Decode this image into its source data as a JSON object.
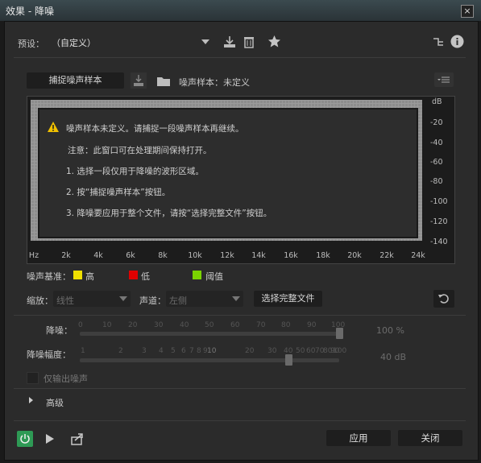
{
  "window": {
    "title": "效果 - 降噪",
    "close_glyph": "×"
  },
  "preset": {
    "label": "预设：",
    "value": "（自定义）",
    "icons": [
      "download-icon",
      "trash-icon",
      "star-icon"
    ],
    "right_icons": [
      "routing-icon",
      "info-icon"
    ]
  },
  "capture": {
    "button": "捕捉噪声样本",
    "sample_label": "噪声样本：未定义",
    "icons": [
      "save-icon",
      "folder-icon",
      "menu-list-icon"
    ]
  },
  "graph": {
    "y_ticks": [
      "dB",
      "-20",
      "-40",
      "-60",
      "-80",
      "-100",
      "-120",
      "-140"
    ],
    "x_ticks": [
      "Hz",
      "2k",
      "4k",
      "6k",
      "8k",
      "10k",
      "12k",
      "14k",
      "16k",
      "18k",
      "20k",
      "22k",
      "24k"
    ]
  },
  "message": {
    "warning": "噪声样本未定义。请捕捉一段噪声样本再继续。",
    "note": "注意：此窗口可在处理期间保持打开。",
    "step1": "1. 选择一段仅用于降噪的波形区域。",
    "step2": "2. 按“捕捉噪声样本”按钮。",
    "step3": "3. 降噪要应用于整个文件，请按“选择完整文件”按钮。"
  },
  "legend": {
    "label": "噪声基准：",
    "items": [
      {
        "label": "高",
        "color": "#f0e000"
      },
      {
        "label": "低",
        "color": "#e00000"
      },
      {
        "label": "阈值",
        "color": "#7ad400"
      }
    ]
  },
  "controls": {
    "scale_label": "缩放：",
    "scale_value": "线性",
    "channel_label": "声道：",
    "channel_value": "左侧",
    "select_file_button": "选择完整文件"
  },
  "noise_reduction": {
    "label": "降噪：",
    "scale": [
      "0",
      "10",
      "20",
      "30",
      "40",
      "50",
      "60",
      "70",
      "80",
      "90",
      "100"
    ],
    "value_text": "100 %",
    "level": 1.0
  },
  "reduce_by": {
    "label": "降噪幅度：",
    "scale_small": [
      "1",
      "2",
      "3",
      "4",
      "5",
      "6",
      "7",
      "8",
      "9"
    ],
    "scale_ten": "10",
    "scale_big": [
      "20",
      "30",
      "40",
      "50",
      "60",
      "70",
      "80",
      "90",
      "100"
    ],
    "value_text": "40 dB",
    "level": 0.4
  },
  "output_noise_only": {
    "label": "仅输出噪声"
  },
  "advanced": {
    "label": "高级"
  },
  "footer": {
    "apply": "应用",
    "close": "关闭",
    "icons": [
      "power-icon",
      "play-icon",
      "export-icon"
    ]
  }
}
